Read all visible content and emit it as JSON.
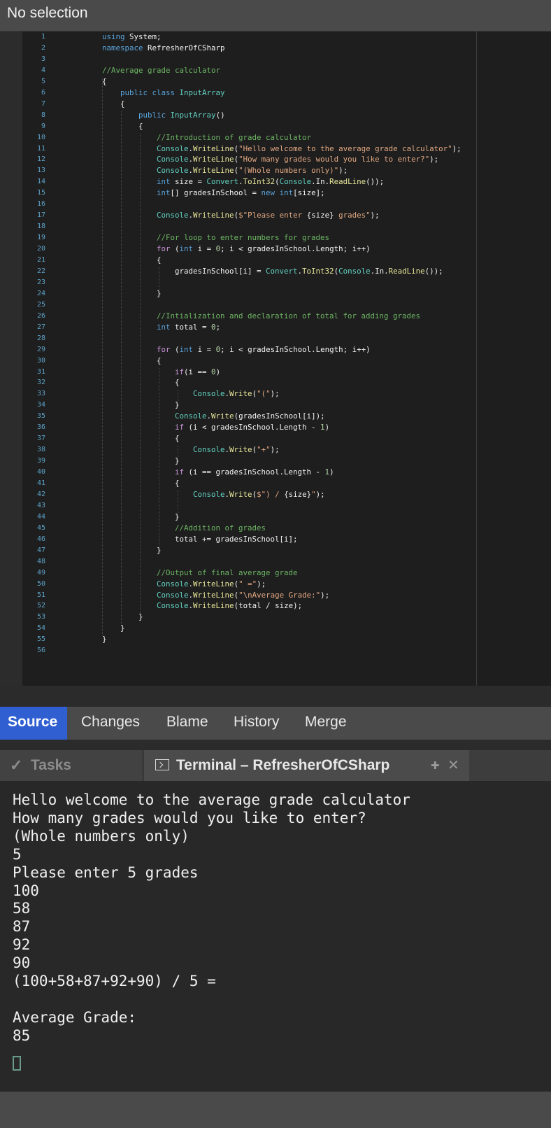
{
  "topbar": {
    "title": "No selection"
  },
  "code_lines": [
    {
      "n": "1",
      "tokens": [
        {
          "c": "kw",
          "t": "using"
        },
        {
          "c": "id",
          "t": " System;"
        }
      ]
    },
    {
      "n": "2",
      "tokens": [
        {
          "c": "kw",
          "t": "namespace"
        },
        {
          "c": "id",
          "t": " RefresherOfCSharp"
        }
      ]
    },
    {
      "n": "3",
      "tokens": []
    },
    {
      "n": "4",
      "tokens": [
        {
          "c": "com",
          "t": "//Average grade calculator"
        }
      ]
    },
    {
      "n": "5",
      "tokens": [
        {
          "c": "id",
          "t": "{"
        }
      ]
    },
    {
      "n": "6",
      "tokens": [
        {
          "c": "id",
          "t": "    "
        },
        {
          "c": "kw",
          "t": "public class"
        },
        {
          "c": "id",
          "t": " "
        },
        {
          "c": "cls",
          "t": "InputArray"
        }
      ]
    },
    {
      "n": "7",
      "tokens": [
        {
          "c": "id",
          "t": "    {"
        }
      ]
    },
    {
      "n": "8",
      "tokens": [
        {
          "c": "id",
          "t": "        "
        },
        {
          "c": "kw",
          "t": "public"
        },
        {
          "c": "id",
          "t": " "
        },
        {
          "c": "cls",
          "t": "InputArray"
        },
        {
          "c": "id",
          "t": "()"
        }
      ]
    },
    {
      "n": "9",
      "tokens": [
        {
          "c": "id",
          "t": "        {"
        }
      ]
    },
    {
      "n": "10",
      "tokens": [
        {
          "c": "id",
          "t": "            "
        },
        {
          "c": "com",
          "t": "//Introduction of grade calculator"
        }
      ]
    },
    {
      "n": "11",
      "tokens": [
        {
          "c": "id",
          "t": "            "
        },
        {
          "c": "cls",
          "t": "Console"
        },
        {
          "c": "id",
          "t": "."
        },
        {
          "c": "fn",
          "t": "WriteLine"
        },
        {
          "c": "id",
          "t": "("
        },
        {
          "c": "str",
          "t": "\"Hello welcome to the average grade calculator\""
        },
        {
          "c": "id",
          "t": ");"
        }
      ]
    },
    {
      "n": "12",
      "tokens": [
        {
          "c": "id",
          "t": "            "
        },
        {
          "c": "cls",
          "t": "Console"
        },
        {
          "c": "id",
          "t": "."
        },
        {
          "c": "fn",
          "t": "WriteLine"
        },
        {
          "c": "id",
          "t": "("
        },
        {
          "c": "str",
          "t": "\"How many grades would you like to enter?\""
        },
        {
          "c": "id",
          "t": ");"
        }
      ]
    },
    {
      "n": "13",
      "tokens": [
        {
          "c": "id",
          "t": "            "
        },
        {
          "c": "cls",
          "t": "Console"
        },
        {
          "c": "id",
          "t": "."
        },
        {
          "c": "fn",
          "t": "WriteLine"
        },
        {
          "c": "id",
          "t": "("
        },
        {
          "c": "str",
          "t": "\"(Whole numbers only)\""
        },
        {
          "c": "id",
          "t": ");"
        }
      ]
    },
    {
      "n": "14",
      "tokens": [
        {
          "c": "id",
          "t": "            "
        },
        {
          "c": "ty",
          "t": "int"
        },
        {
          "c": "id",
          "t": " size = "
        },
        {
          "c": "cls",
          "t": "Convert"
        },
        {
          "c": "id",
          "t": "."
        },
        {
          "c": "fn",
          "t": "ToInt32"
        },
        {
          "c": "id",
          "t": "("
        },
        {
          "c": "cls",
          "t": "Console"
        },
        {
          "c": "id",
          "t": ".In."
        },
        {
          "c": "fn",
          "t": "ReadLine"
        },
        {
          "c": "id",
          "t": "());"
        }
      ]
    },
    {
      "n": "15",
      "tokens": [
        {
          "c": "id",
          "t": "            "
        },
        {
          "c": "ty",
          "t": "int"
        },
        {
          "c": "id",
          "t": "[] gradesInSchool = "
        },
        {
          "c": "kw",
          "t": "new"
        },
        {
          "c": "id",
          "t": " "
        },
        {
          "c": "ty",
          "t": "int"
        },
        {
          "c": "id",
          "t": "[size];"
        }
      ]
    },
    {
      "n": "16",
      "tokens": []
    },
    {
      "n": "17",
      "tokens": [
        {
          "c": "id",
          "t": "            "
        },
        {
          "c": "cls",
          "t": "Console"
        },
        {
          "c": "id",
          "t": "."
        },
        {
          "c": "fn",
          "t": "WriteLine"
        },
        {
          "c": "id",
          "t": "("
        },
        {
          "c": "str",
          "t": "$\"Please enter "
        },
        {
          "c": "id",
          "t": "{size}"
        },
        {
          "c": "str",
          "t": " grades\""
        },
        {
          "c": "id",
          "t": ");"
        }
      ]
    },
    {
      "n": "18",
      "tokens": []
    },
    {
      "n": "19",
      "tokens": [
        {
          "c": "id",
          "t": "            "
        },
        {
          "c": "com",
          "t": "//For loop to enter numbers for grades"
        }
      ]
    },
    {
      "n": "20",
      "tokens": [
        {
          "c": "id",
          "t": "            "
        },
        {
          "c": "ctl",
          "t": "for"
        },
        {
          "c": "id",
          "t": " ("
        },
        {
          "c": "ty",
          "t": "int"
        },
        {
          "c": "id",
          "t": " i = "
        },
        {
          "c": "num",
          "t": "0"
        },
        {
          "c": "id",
          "t": "; i < gradesInSchool.Length; i++)"
        }
      ]
    },
    {
      "n": "21",
      "tokens": [
        {
          "c": "id",
          "t": "            {"
        }
      ]
    },
    {
      "n": "22",
      "tokens": [
        {
          "c": "id",
          "t": "                gradesInSchool[i] = "
        },
        {
          "c": "cls",
          "t": "Convert"
        },
        {
          "c": "id",
          "t": "."
        },
        {
          "c": "fn",
          "t": "ToInt32"
        },
        {
          "c": "id",
          "t": "("
        },
        {
          "c": "cls",
          "t": "Console"
        },
        {
          "c": "id",
          "t": ".In."
        },
        {
          "c": "fn",
          "t": "ReadLine"
        },
        {
          "c": "id",
          "t": "());"
        }
      ]
    },
    {
      "n": "23",
      "tokens": []
    },
    {
      "n": "24",
      "tokens": [
        {
          "c": "id",
          "t": "            }"
        }
      ]
    },
    {
      "n": "25",
      "tokens": []
    },
    {
      "n": "26",
      "tokens": [
        {
          "c": "id",
          "t": "            "
        },
        {
          "c": "com",
          "t": "//Intialization and declaration of total for adding grades"
        }
      ]
    },
    {
      "n": "27",
      "tokens": [
        {
          "c": "id",
          "t": "            "
        },
        {
          "c": "ty",
          "t": "int"
        },
        {
          "c": "id",
          "t": " total = "
        },
        {
          "c": "num",
          "t": "0"
        },
        {
          "c": "id",
          "t": ";"
        }
      ]
    },
    {
      "n": "28",
      "tokens": []
    },
    {
      "n": "29",
      "tokens": [
        {
          "c": "id",
          "t": "            "
        },
        {
          "c": "ctl",
          "t": "for"
        },
        {
          "c": "id",
          "t": " ("
        },
        {
          "c": "ty",
          "t": "int"
        },
        {
          "c": "id",
          "t": " i = "
        },
        {
          "c": "num",
          "t": "0"
        },
        {
          "c": "id",
          "t": "; i < gradesInSchool.Length; i++)"
        }
      ]
    },
    {
      "n": "30",
      "tokens": [
        {
          "c": "id",
          "t": "            {"
        }
      ]
    },
    {
      "n": "31",
      "tokens": [
        {
          "c": "id",
          "t": "                "
        },
        {
          "c": "ctl",
          "t": "if"
        },
        {
          "c": "id",
          "t": "(i == "
        },
        {
          "c": "num",
          "t": "0"
        },
        {
          "c": "id",
          "t": ")"
        }
      ]
    },
    {
      "n": "32",
      "tokens": [
        {
          "c": "id",
          "t": "                {"
        }
      ]
    },
    {
      "n": "33",
      "tokens": [
        {
          "c": "id",
          "t": "                    "
        },
        {
          "c": "cls",
          "t": "Console"
        },
        {
          "c": "id",
          "t": "."
        },
        {
          "c": "fn",
          "t": "Write"
        },
        {
          "c": "id",
          "t": "("
        },
        {
          "c": "str",
          "t": "\"(\""
        },
        {
          "c": "id",
          "t": ");"
        }
      ]
    },
    {
      "n": "34",
      "tokens": [
        {
          "c": "id",
          "t": "                }"
        }
      ]
    },
    {
      "n": "35",
      "tokens": [
        {
          "c": "id",
          "t": "                "
        },
        {
          "c": "cls",
          "t": "Console"
        },
        {
          "c": "id",
          "t": "."
        },
        {
          "c": "fn",
          "t": "Write"
        },
        {
          "c": "id",
          "t": "(gradesInSchool[i]);"
        }
      ]
    },
    {
      "n": "36",
      "tokens": [
        {
          "c": "id",
          "t": "                "
        },
        {
          "c": "ctl",
          "t": "if"
        },
        {
          "c": "id",
          "t": " (i < gradesInSchool.Length - "
        },
        {
          "c": "num",
          "t": "1"
        },
        {
          "c": "id",
          "t": ")"
        }
      ]
    },
    {
      "n": "37",
      "tokens": [
        {
          "c": "id",
          "t": "                {"
        }
      ]
    },
    {
      "n": "38",
      "tokens": [
        {
          "c": "id",
          "t": "                    "
        },
        {
          "c": "cls",
          "t": "Console"
        },
        {
          "c": "id",
          "t": "."
        },
        {
          "c": "fn",
          "t": "Write"
        },
        {
          "c": "id",
          "t": "("
        },
        {
          "c": "str",
          "t": "\"+\""
        },
        {
          "c": "id",
          "t": ");"
        }
      ]
    },
    {
      "n": "39",
      "tokens": [
        {
          "c": "id",
          "t": "                }"
        }
      ]
    },
    {
      "n": "40",
      "tokens": [
        {
          "c": "id",
          "t": "                "
        },
        {
          "c": "ctl",
          "t": "if"
        },
        {
          "c": "id",
          "t": " (i == gradesInSchool.Length - "
        },
        {
          "c": "num",
          "t": "1"
        },
        {
          "c": "id",
          "t": ")"
        }
      ]
    },
    {
      "n": "41",
      "tokens": [
        {
          "c": "id",
          "t": "                {"
        }
      ]
    },
    {
      "n": "42",
      "tokens": [
        {
          "c": "id",
          "t": "                    "
        },
        {
          "c": "cls",
          "t": "Console"
        },
        {
          "c": "id",
          "t": "."
        },
        {
          "c": "fn",
          "t": "Write"
        },
        {
          "c": "id",
          "t": "("
        },
        {
          "c": "str",
          "t": "$\") / "
        },
        {
          "c": "id",
          "t": "{size}"
        },
        {
          "c": "str",
          "t": "\""
        },
        {
          "c": "id",
          "t": ");"
        }
      ]
    },
    {
      "n": "43",
      "tokens": []
    },
    {
      "n": "44",
      "tokens": [
        {
          "c": "id",
          "t": "                }"
        }
      ]
    },
    {
      "n": "45",
      "tokens": [
        {
          "c": "id",
          "t": "                "
        },
        {
          "c": "com",
          "t": "//Addition of grades"
        }
      ]
    },
    {
      "n": "46",
      "tokens": [
        {
          "c": "id",
          "t": "                total += gradesInSchool[i];"
        }
      ]
    },
    {
      "n": "47",
      "tokens": [
        {
          "c": "id",
          "t": "            }"
        }
      ]
    },
    {
      "n": "48",
      "tokens": []
    },
    {
      "n": "49",
      "tokens": [
        {
          "c": "id",
          "t": "            "
        },
        {
          "c": "com",
          "t": "//Output of final average grade"
        }
      ]
    },
    {
      "n": "50",
      "tokens": [
        {
          "c": "id",
          "t": "            "
        },
        {
          "c": "cls",
          "t": "Console"
        },
        {
          "c": "id",
          "t": "."
        },
        {
          "c": "fn",
          "t": "WriteLine"
        },
        {
          "c": "id",
          "t": "("
        },
        {
          "c": "str",
          "t": "\" =\""
        },
        {
          "c": "id",
          "t": ");"
        }
      ]
    },
    {
      "n": "51",
      "tokens": [
        {
          "c": "id",
          "t": "            "
        },
        {
          "c": "cls",
          "t": "Console"
        },
        {
          "c": "id",
          "t": "."
        },
        {
          "c": "fn",
          "t": "WriteLine"
        },
        {
          "c": "id",
          "t": "("
        },
        {
          "c": "str",
          "t": "\"\\nAverage Grade:\""
        },
        {
          "c": "id",
          "t": ");"
        }
      ]
    },
    {
      "n": "52",
      "tokens": [
        {
          "c": "id",
          "t": "            "
        },
        {
          "c": "cls",
          "t": "Console"
        },
        {
          "c": "id",
          "t": "."
        },
        {
          "c": "fn",
          "t": "WriteLine"
        },
        {
          "c": "id",
          "t": "(total / size);"
        }
      ]
    },
    {
      "n": "53",
      "tokens": [
        {
          "c": "id",
          "t": "        }"
        }
      ]
    },
    {
      "n": "54",
      "tokens": [
        {
          "c": "id",
          "t": "    }"
        }
      ]
    },
    {
      "n": "55",
      "tokens": [
        {
          "c": "id",
          "t": "}"
        }
      ]
    },
    {
      "n": "56",
      "tokens": []
    }
  ],
  "editor_tabs": {
    "source": "Source",
    "changes": "Changes",
    "blame": "Blame",
    "history": "History",
    "merge": "Merge"
  },
  "pad_tabs": {
    "tasks": "Tasks",
    "terminal": "Terminal – RefresherOfCSharp",
    "pin_icon": "pin-icon",
    "close_icon": "close-icon"
  },
  "terminal_output": [
    "Hello welcome to the average grade calculator",
    "How many grades would you like to enter?",
    "(Whole numbers only)",
    "5",
    "Please enter 5 grades",
    "100",
    "58",
    "87",
    "92",
    "90",
    "(100+58+87+92+90) / 5 =",
    "",
    "Average Grade:",
    "85"
  ],
  "colors": {
    "active_tab": "#2f5fd0",
    "editor_bg": "#1e1e1e",
    "terminal_bg": "#282828"
  }
}
